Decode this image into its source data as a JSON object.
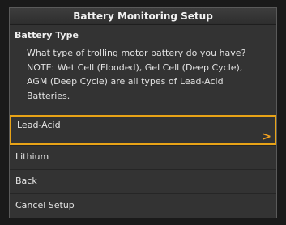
{
  "dialog": {
    "title": "Battery Monitoring Setup",
    "section_title": "Battery Type",
    "description": "What type of trolling motor battery do you have? NOTE: Wet Cell (Flooded), Gel Cell (Deep Cycle), AGM (Deep Cycle) are all types of Lead-Acid Batteries."
  },
  "menu": {
    "items": [
      {
        "label": "Lead-Acid",
        "selected": true
      },
      {
        "label": "Lithium",
        "selected": false
      },
      {
        "label": "Back",
        "selected": false
      },
      {
        "label": "Cancel Setup",
        "selected": false
      }
    ],
    "selected_indicator": ">"
  },
  "colors": {
    "highlight": "#e8a317",
    "background": "#333333",
    "text": "#e6e6e6"
  }
}
